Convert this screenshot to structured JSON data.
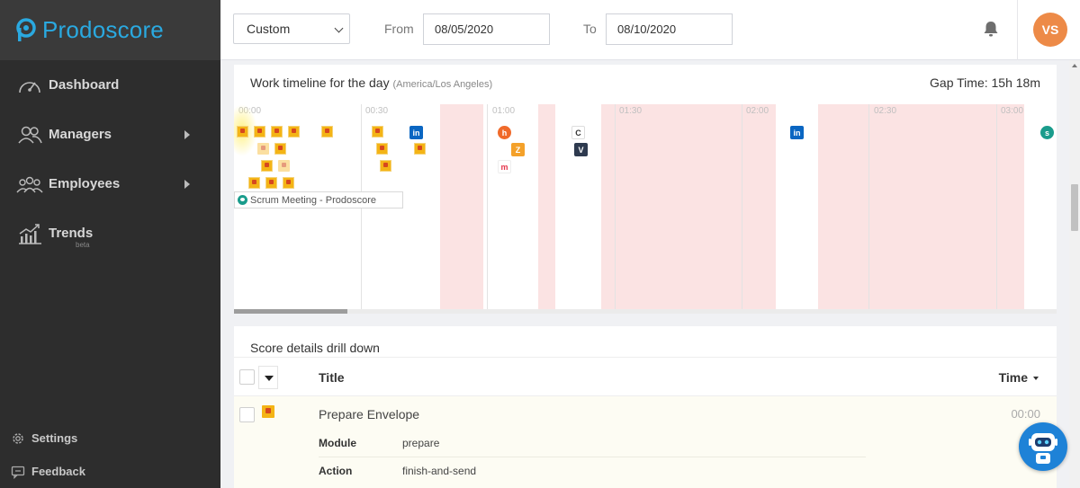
{
  "app": {
    "name": "Prodoscore",
    "brand_color": "#2aa9e0"
  },
  "sidebar": {
    "items": [
      {
        "label": "Dashboard",
        "icon": "speedometer-icon"
      },
      {
        "label": "Managers",
        "icon": "managers-icon",
        "has_submenu": true
      },
      {
        "label": "Employees",
        "icon": "employees-icon",
        "has_submenu": true
      },
      {
        "label": "Trends",
        "icon": "trends-icon",
        "badge": "beta"
      }
    ],
    "bottom": [
      {
        "label": "Settings",
        "icon": "gear-icon"
      },
      {
        "label": "Feedback",
        "icon": "feedback-icon"
      }
    ]
  },
  "header": {
    "range_select": "Custom",
    "from_label": "From",
    "from_value": "08/05/2020",
    "to_label": "To",
    "to_value": "08/10/2020",
    "avatar_initials": "VS",
    "avatar_color": "#ed8a47"
  },
  "timeline": {
    "title": "Work timeline for the day",
    "timezone": "(America/Los Angeles)",
    "gap_time": "Gap Time: 15h 18m",
    "ticks": [
      "00:00",
      "00:30",
      "01:00",
      "01:30",
      "02:00",
      "02:30",
      "03:00"
    ],
    "meeting_label": "Scrum Meeting - Prodoscore",
    "gap_color": "#fbe3e3"
  },
  "drilldown": {
    "title": "Score details drill down",
    "col_title": "Title",
    "col_time": "Time",
    "row": {
      "title": "Prepare Envelope",
      "time": "00:00",
      "module_key": "Module",
      "module_value": "prepare",
      "action_key": "Action",
      "action_value": "finish-and-send"
    }
  }
}
